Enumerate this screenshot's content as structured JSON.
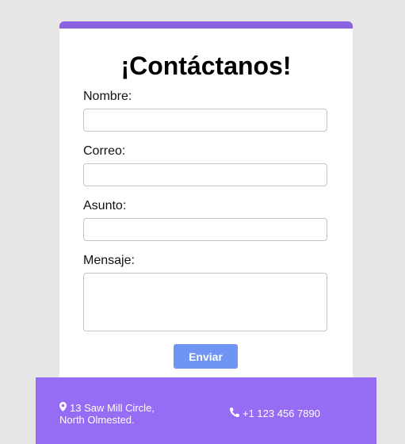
{
  "form": {
    "title": "¡Contáctanos!",
    "fields": [
      {
        "label": "Nombre:",
        "value": "",
        "placeholder": ""
      },
      {
        "label": "Correo:",
        "value": "",
        "placeholder": ""
      },
      {
        "label": "Asunto:",
        "value": "",
        "placeholder": ""
      },
      {
        "label": "Mensaje:",
        "value": "",
        "placeholder": ""
      }
    ],
    "submit_label": "Enviar"
  },
  "footer": {
    "address_line1": "13 Saw Mill Circle,",
    "address_line2": "North Olmested.",
    "phone": "+1 123 456 7890",
    "address_icon": "map-marker-icon",
    "phone_icon": "phone-icon"
  },
  "colors": {
    "accent_bar": "#8a62e0",
    "footer_bg": "#956cf3",
    "button_bg": "#6f94f3",
    "page_bg": "#e6e6e6"
  }
}
